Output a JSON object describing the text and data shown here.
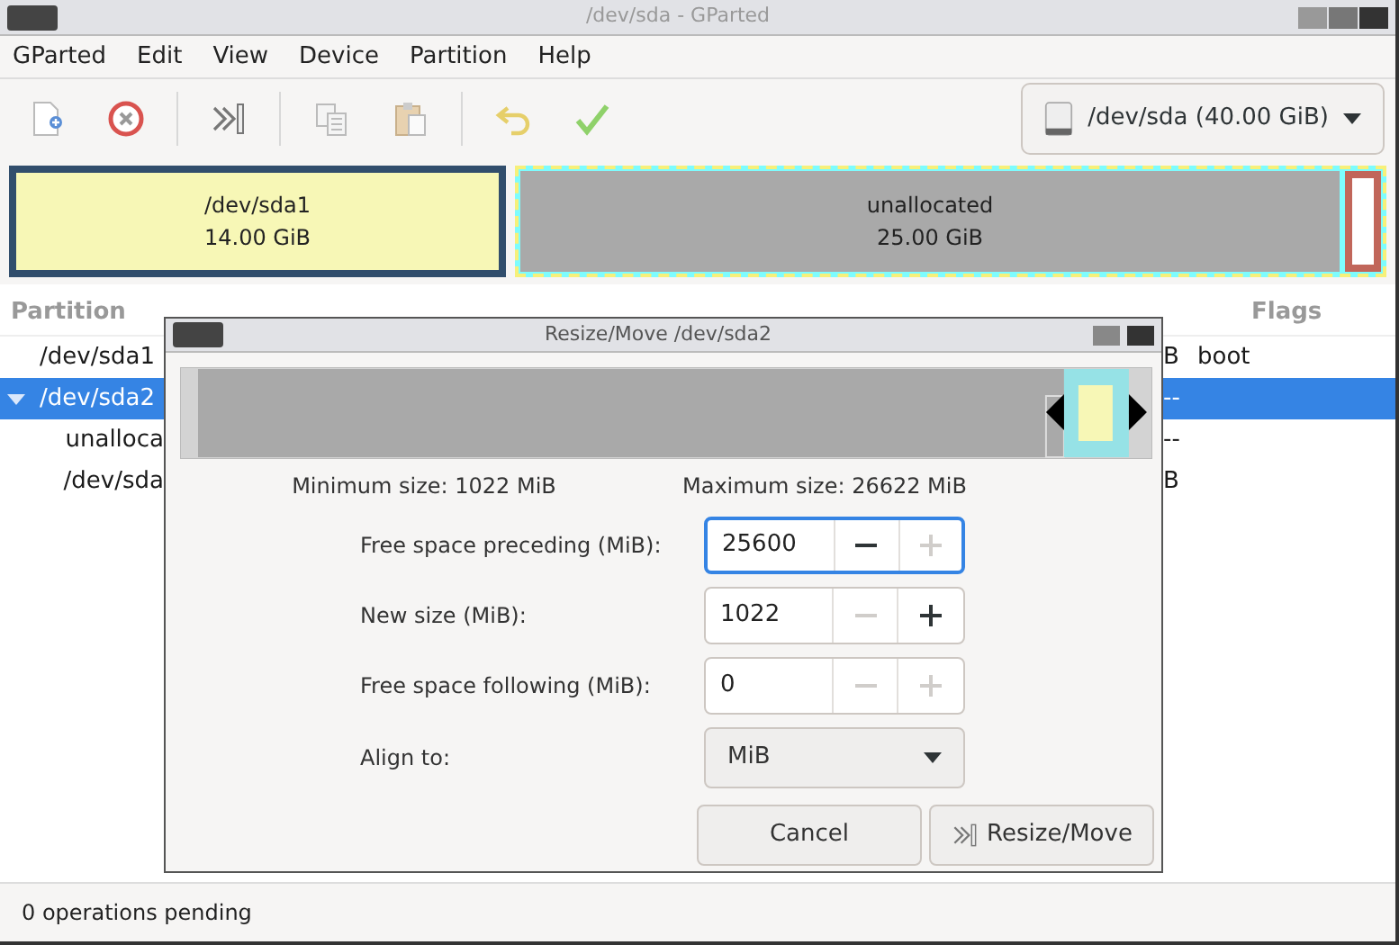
{
  "window": {
    "title": "/dev/sda - GParted"
  },
  "menu": [
    "GParted",
    "Edit",
    "View",
    "Device",
    "Partition",
    "Help"
  ],
  "device_selector": {
    "label": "/dev/sda (40.00 GiB)"
  },
  "disk_map": [
    {
      "kind": "partition",
      "name": "/dev/sda1",
      "size": "14.00 GiB",
      "color": "#314e6c",
      "selected": false
    },
    {
      "kind": "extended",
      "color": "#7dfcfe",
      "selected": true,
      "children": [
        {
          "kind": "unallocated",
          "name": "unallocated",
          "size": "25.00 GiB",
          "color": "#a9a9a9",
          "selected": false
        },
        {
          "kind": "partition",
          "color": "#c1665a",
          "selected": false
        }
      ]
    }
  ],
  "table": {
    "columns": [
      "Partition",
      "Flags"
    ],
    "rows": [
      {
        "partition": "/dev/sda1",
        "column_6": "B",
        "flags": "boot",
        "selected": false
      },
      {
        "partition": "/dev/sda2",
        "column_6": "--",
        "selected": true,
        "expanded": true,
        "children": [
          {
            "partition": "unalloca",
            "column_6": "--",
            "selected": false
          },
          {
            "partition": "/dev/sda",
            "column_6": "B",
            "selected": false
          }
        ]
      }
    ]
  },
  "status_bar": "0 operations pending",
  "dialog": {
    "title": "Resize/Move /dev/sda2",
    "slider": {
      "level": 0.96
    },
    "minimum": "Minimum size: 1022 MiB",
    "maximum": "Maximum size: 26622 MiB",
    "fields": [
      {
        "kind": "spin",
        "label": "Free space preceding (MiB):",
        "value": "25600",
        "focused": true,
        "minus_enabled": true,
        "plus_enabled": false
      },
      {
        "kind": "spin",
        "label": "New size (MiB):",
        "value": "1022",
        "focused": false,
        "minus_enabled": false,
        "plus_enabled": true
      },
      {
        "kind": "spin",
        "label": "Free space following (MiB):",
        "value": "0",
        "focused": false,
        "minus_enabled": false,
        "plus_enabled": false
      },
      {
        "kind": "dropdown",
        "label": "Align to:",
        "value": "MiB"
      }
    ],
    "buttons": [
      {
        "kind": "cancel",
        "label": "Cancel"
      },
      {
        "kind": "apply",
        "label": "Resize/Move"
      }
    ]
  }
}
